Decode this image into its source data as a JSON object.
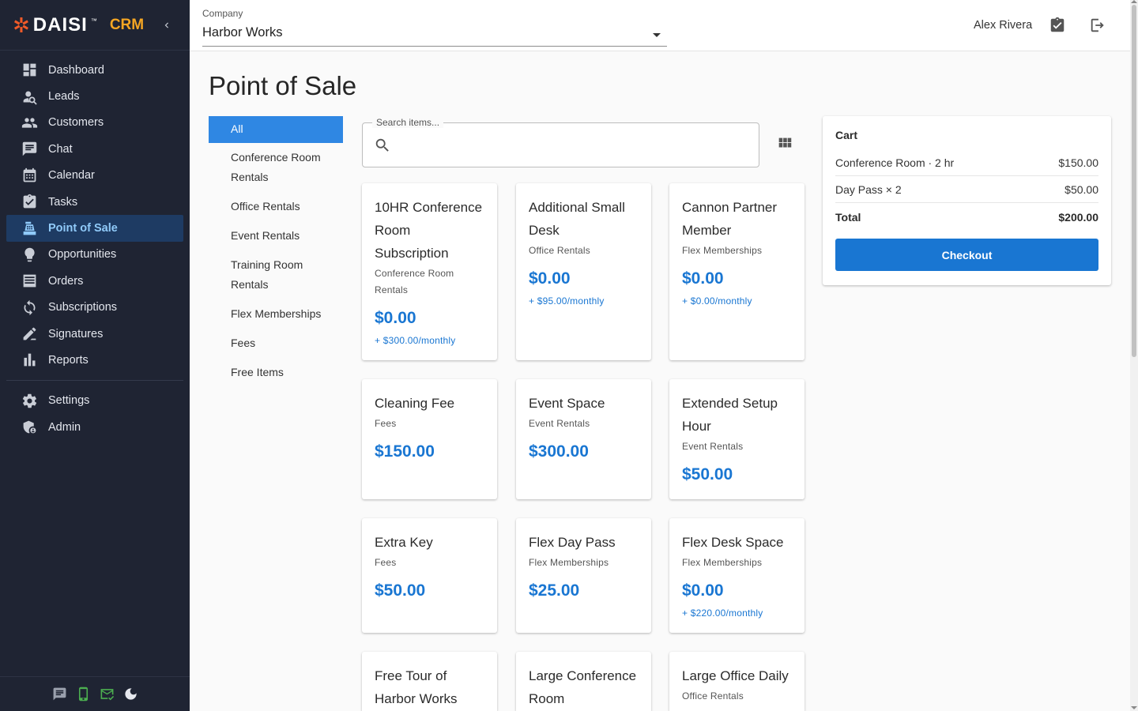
{
  "brand": {
    "name": "DAISI",
    "tm": "™",
    "suffix": "CRM",
    "star": "✲"
  },
  "sidebar": {
    "items": [
      {
        "label": "Dashboard",
        "icon": "dashboard-icon"
      },
      {
        "label": "Leads",
        "icon": "person-search-icon"
      },
      {
        "label": "Customers",
        "icon": "people-icon"
      },
      {
        "label": "Chat",
        "icon": "chat-icon"
      },
      {
        "label": "Calendar",
        "icon": "calendar-icon"
      },
      {
        "label": "Tasks",
        "icon": "task-icon"
      },
      {
        "label": "Point of Sale",
        "icon": "cash-register-icon",
        "active": true
      },
      {
        "label": "Opportunities",
        "icon": "lightbulb-icon"
      },
      {
        "label": "Orders",
        "icon": "list-icon"
      },
      {
        "label": "Subscriptions",
        "icon": "refresh-icon"
      },
      {
        "label": "Signatures",
        "icon": "signature-icon"
      },
      {
        "label": "Reports",
        "icon": "bar-chart-icon"
      }
    ],
    "bottom_items": [
      {
        "label": "Settings",
        "icon": "gear-icon"
      },
      {
        "label": "Admin",
        "icon": "admin-shield-icon"
      }
    ]
  },
  "topbar": {
    "company_label": "Company",
    "company_value": "Harbor Works",
    "user_name": "Alex Rivera"
  },
  "page": {
    "title": "Point of Sale"
  },
  "categories": [
    {
      "label": "All",
      "active": true
    },
    {
      "label": "Conference Room Rentals"
    },
    {
      "label": "Office Rentals"
    },
    {
      "label": "Event Rentals"
    },
    {
      "label": "Training Room Rentals"
    },
    {
      "label": "Flex Memberships"
    },
    {
      "label": "Fees"
    },
    {
      "label": "Free Items"
    }
  ],
  "search": {
    "label": "Search items...",
    "placeholder": ""
  },
  "products": [
    {
      "name": "10HR Conference Room Subscription",
      "category": "Conference Room Rentals",
      "price": "$0.00",
      "sub": "+ $300.00/monthly"
    },
    {
      "name": "Additional Small Desk",
      "category": "Office Rentals",
      "price": "$0.00",
      "sub": "+ $95.00/monthly"
    },
    {
      "name": "Cannon Partner Member",
      "category": "Flex Memberships",
      "price": "$0.00",
      "sub": "+ $0.00/monthly"
    },
    {
      "name": "Cleaning Fee",
      "category": "Fees",
      "price": "$150.00",
      "sub": ""
    },
    {
      "name": "Event Space",
      "category": "Event Rentals",
      "price": "$300.00",
      "sub": ""
    },
    {
      "name": "Extended Setup Hour",
      "category": "Event Rentals",
      "price": "$50.00",
      "sub": ""
    },
    {
      "name": "Extra Key",
      "category": "Fees",
      "price": "$50.00",
      "sub": ""
    },
    {
      "name": "Flex Day Pass",
      "category": "Flex Memberships",
      "price": "$25.00",
      "sub": ""
    },
    {
      "name": "Flex Desk Space",
      "category": "Flex Memberships",
      "price": "$0.00",
      "sub": "+ $220.00/monthly"
    },
    {
      "name": "Free Tour of Harbor Works",
      "category": "",
      "price": "",
      "sub": ""
    },
    {
      "name": "Large Conference Room",
      "category": "",
      "price": "",
      "sub": ""
    },
    {
      "name": "Large Office Daily",
      "category": "Office Rentals",
      "price": "",
      "sub": ""
    }
  ],
  "cart": {
    "title": "Cart",
    "lines": [
      {
        "label": "Conference Room · 2 hr",
        "amount": "$150.00"
      },
      {
        "label": "Day Pass × 2",
        "amount": "$50.00"
      }
    ],
    "total_label": "Total",
    "total_amount": "$200.00",
    "checkout_label": "Checkout"
  },
  "colors": {
    "sidebar_bg": "#1f2433",
    "accent": "#1976d2",
    "brand_orange": "#f05a28",
    "crm_gold": "#f5a623",
    "active_cat": "#2f87e3"
  }
}
